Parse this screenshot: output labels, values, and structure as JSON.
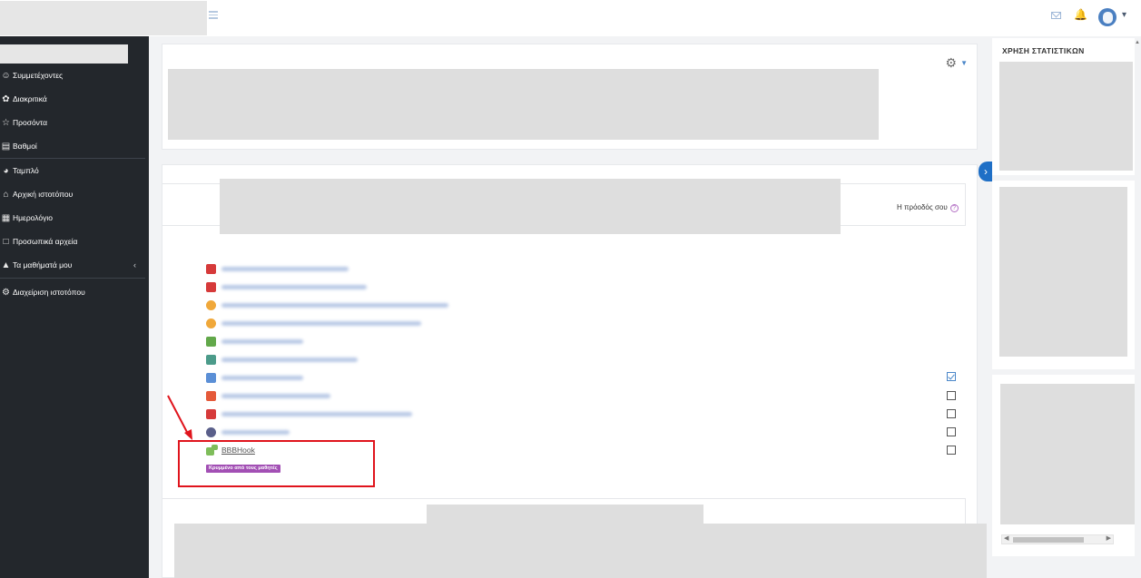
{
  "nav": {
    "items": [
      {
        "label": "Συμμετέχοντες",
        "icon": "users-icon"
      },
      {
        "label": "Διακριτικά",
        "icon": "badges-icon"
      },
      {
        "label": "Προσόντα",
        "icon": "star-icon"
      },
      {
        "label": "Βαθμοί",
        "icon": "grades-icon"
      },
      {
        "label": "Ταμπλό",
        "icon": "dashboard-icon"
      },
      {
        "label": "Αρχική ιστοτόπου",
        "icon": "home-icon"
      },
      {
        "label": "Ημερολόγιο",
        "icon": "calendar-icon"
      },
      {
        "label": "Προσωπικά αρχεία",
        "icon": "files-icon"
      },
      {
        "label": "Τα μαθήματά μου",
        "icon": "graduation-cap-icon"
      },
      {
        "label": "Διαχείριση ιστοτόπου",
        "icon": "gear-icon"
      }
    ],
    "collapse_caret": "‹"
  },
  "course": {
    "progress_label": "Η πρόοδός σου",
    "progress_help": "?"
  },
  "activity": {
    "link_label": "BBBHook",
    "hidden_badge": "Κρυμμένο από τους μαθητές"
  },
  "block": {
    "title": "ΧΡΗΣΗ ΣΤΑΤΙΣΤΙΚΩΝ"
  },
  "colors": {
    "sidebar_bg": "#23272c",
    "accent": "#1f6fc6",
    "badge": "#a24fb4",
    "highlight": "#e0141c"
  },
  "completion": [
    true,
    false,
    false,
    false,
    false
  ]
}
